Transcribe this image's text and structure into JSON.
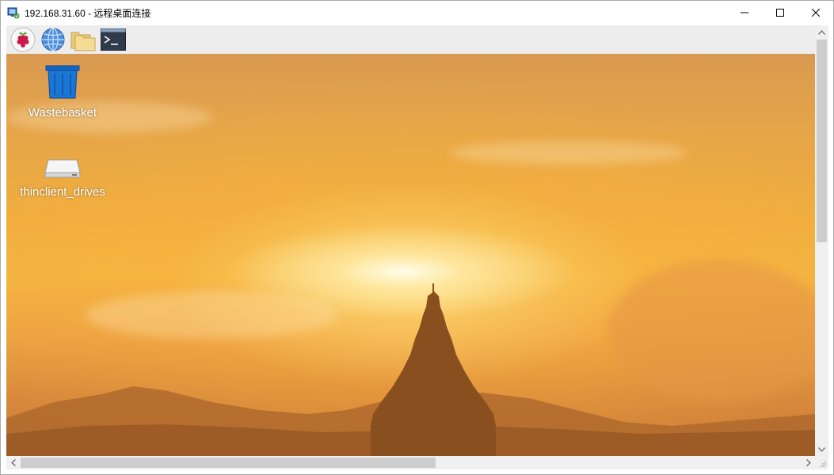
{
  "window": {
    "title": "192.168.31.60 - 远程桌面连接"
  },
  "taskbar": {
    "items": [
      {
        "icon": "raspberry-pi-menu-icon"
      },
      {
        "icon": "web-browser-icon"
      },
      {
        "icon": "file-manager-icon"
      },
      {
        "icon": "terminal-icon"
      }
    ]
  },
  "desktop": {
    "icons": [
      {
        "label": "Wastebasket",
        "icon": "wastebasket-icon"
      },
      {
        "label": "thinclient_drives",
        "icon": "drive-icon"
      }
    ]
  },
  "colors": {
    "accent_blue": "#1565c0",
    "sky_orange": "#f0ad3f"
  }
}
